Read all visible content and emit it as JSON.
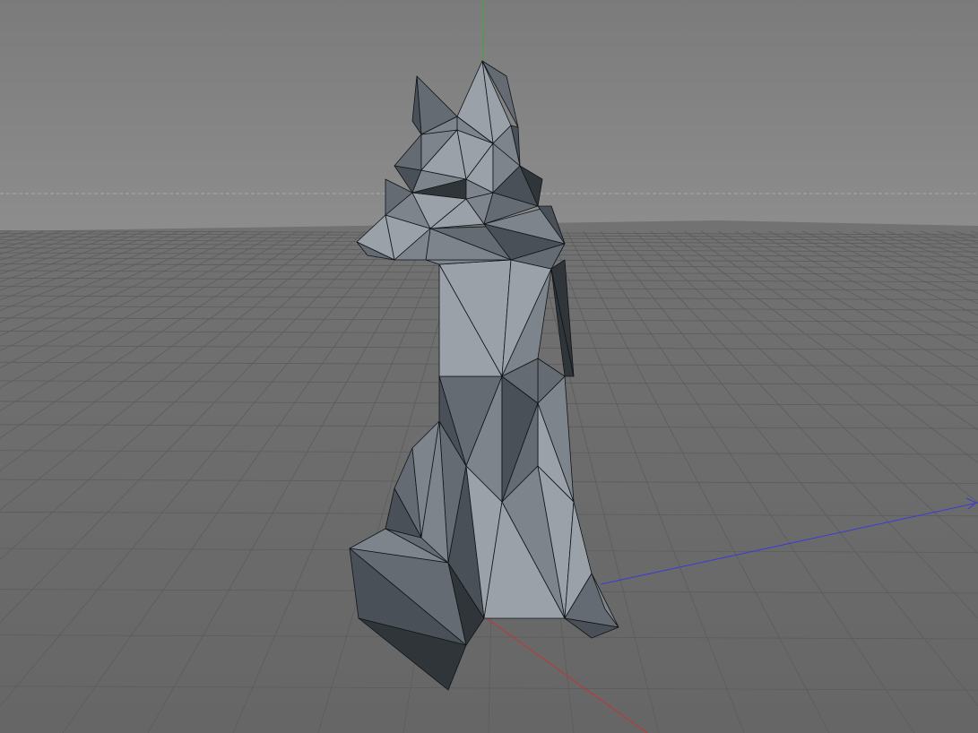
{
  "viewport": {
    "name": "3d-perspective-viewport",
    "colors": {
      "sky_top": "#7b7b7b",
      "sky_bottom": "#8d8d8d",
      "floor_far": "#727272",
      "floor_near": "#666666",
      "grid_line": "#5c5c5c",
      "grid_major": "#555555",
      "horizon_dash": "#a9a9a9",
      "axis_x": "#c83232",
      "axis_y": "#3ca63c",
      "axis_z": "#3b3bd6",
      "model_edge": "#101418"
    }
  },
  "model": {
    "name": "low-poly-fox",
    "shades": {
      "light": "#9aa1a8",
      "mid": "#7d848b",
      "midDark": "#646b72",
      "dark": "#4a5057",
      "darkest": "#30353a"
    }
  }
}
